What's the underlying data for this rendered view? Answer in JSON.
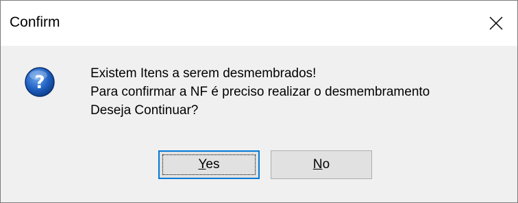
{
  "window": {
    "title": "Confirm"
  },
  "icons": {
    "dialog_icon": "question-icon",
    "close": "close-icon"
  },
  "message": {
    "line1": "Existem Itens a serem desmembrados!",
    "line2": "Para confirmar a NF é preciso realizar o desmembramento",
    "line3": "Deseja Continuar?"
  },
  "buttons": {
    "yes": {
      "mnemonic": "Y",
      "rest": "es"
    },
    "no": {
      "mnemonic": "N",
      "rest": "o"
    }
  },
  "colors": {
    "focus_border": "#0078d7",
    "icon_blue": "#1f5fbf",
    "background": "#f0f0f0"
  }
}
